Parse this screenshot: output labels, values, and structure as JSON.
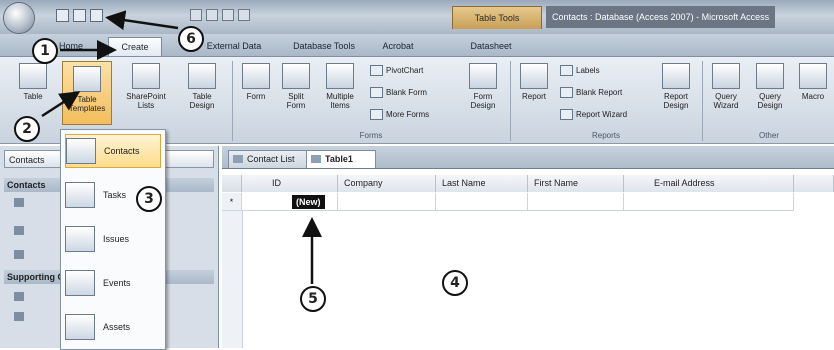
{
  "titlebar": {
    "contextual_tab": "Table Tools",
    "window_title": "Contacts : Database (Access 2007) - Microsoft Access"
  },
  "tabs": [
    {
      "label": "Home"
    },
    {
      "label": "Create"
    },
    {
      "label": "External Data"
    },
    {
      "label": "Database Tools"
    },
    {
      "label": "Acrobat"
    },
    {
      "label": "Datasheet"
    }
  ],
  "ribbon": {
    "tables": {
      "table": "Table",
      "table_templates": "Table Templates",
      "sharepoint_lists": "SharePoint Lists",
      "table_design": "Table Design"
    },
    "forms": {
      "form": "Form",
      "split_form": "Split Form",
      "multiple_items": "Multiple Items",
      "pivotchart": "PivotChart",
      "blank_form": "Blank Form",
      "more_forms": "More Forms",
      "form_design": "Form Design",
      "group_label": "Forms"
    },
    "reports": {
      "report": "Report",
      "labels": "Labels",
      "blank_report": "Blank Report",
      "report_wizard": "Report Wizard",
      "report_design": "Report Design",
      "group_label": "Reports"
    },
    "other": {
      "query_wizard": "Query Wizard",
      "query_design": "Query Design",
      "macro": "Macro",
      "group_label": "Other"
    }
  },
  "nav": {
    "header": "Contacts",
    "group1": "Contacts",
    "group2": "Supporting Objects"
  },
  "template_menu": [
    {
      "label": "Contacts"
    },
    {
      "label": "Tasks"
    },
    {
      "label": "Issues"
    },
    {
      "label": "Events"
    },
    {
      "label": "Assets"
    }
  ],
  "doc_tabs": [
    {
      "label": "Contact List"
    },
    {
      "label": "Table1"
    }
  ],
  "columns": [
    "ID",
    "Company",
    "Last Name",
    "First Name",
    "E-mail Address"
  ],
  "new_row": {
    "marker": "*",
    "id_value": "(New)"
  },
  "callouts": [
    "1",
    "2",
    "3",
    "4",
    "5",
    "6"
  ]
}
